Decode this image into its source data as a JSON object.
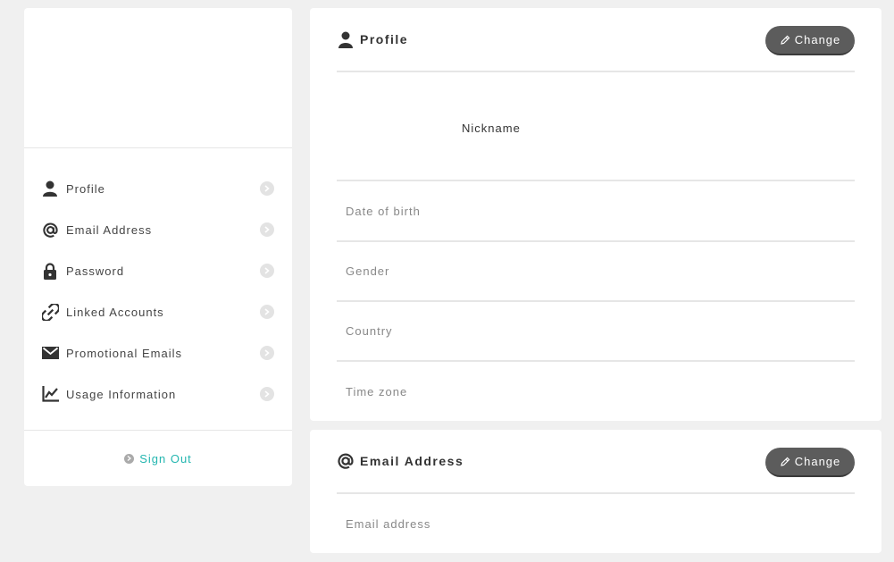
{
  "sidebar": {
    "items": [
      {
        "label": "Profile",
        "icon": "person-icon"
      },
      {
        "label": "Email Address",
        "icon": "at-icon"
      },
      {
        "label": "Password",
        "icon": "lock-icon"
      },
      {
        "label": "Linked Accounts",
        "icon": "link-icon"
      },
      {
        "label": "Promotional Emails",
        "icon": "envelope-icon"
      },
      {
        "label": "Usage Information",
        "icon": "chart-icon"
      }
    ],
    "sign_out_label": "Sign Out"
  },
  "profile_card": {
    "title": "Profile",
    "change_label": "Change",
    "nickname_label": "Nickname",
    "fields": [
      "Date of birth",
      "Gender",
      "Country",
      "Time zone"
    ]
  },
  "email_card": {
    "title": "Email Address",
    "change_label": "Change",
    "field": "Email address"
  },
  "colors": {
    "accent": "#24b6b0",
    "button": "#5c5c5c",
    "background": "#f0f0f0"
  }
}
